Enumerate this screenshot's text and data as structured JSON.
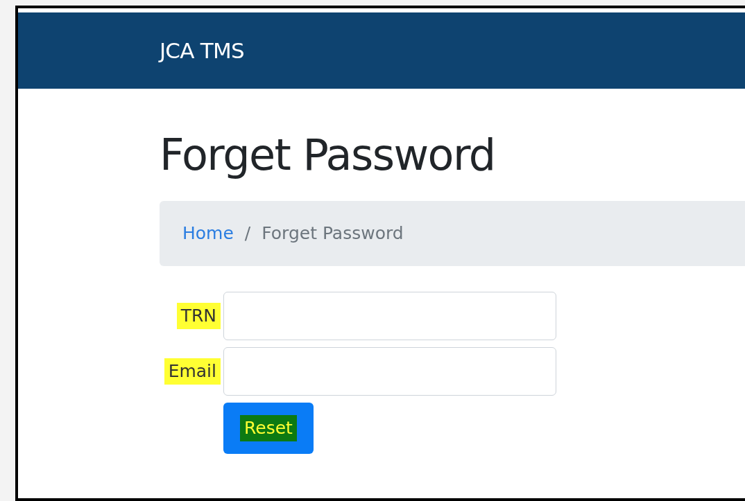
{
  "navbar": {
    "brand": "JCA TMS"
  },
  "heading": "Forget Password",
  "breadcrumb": [
    {
      "label": "Home",
      "kind": "link"
    },
    {
      "label": "/",
      "kind": "separator"
    },
    {
      "label": "Forget Password",
      "kind": "current"
    }
  ],
  "form": {
    "fields": [
      {
        "label": "TRN",
        "highlighted": true
      },
      {
        "label": "Email",
        "highlighted": true
      }
    ],
    "button": {
      "label": "Reset",
      "highlighted": true
    }
  }
}
